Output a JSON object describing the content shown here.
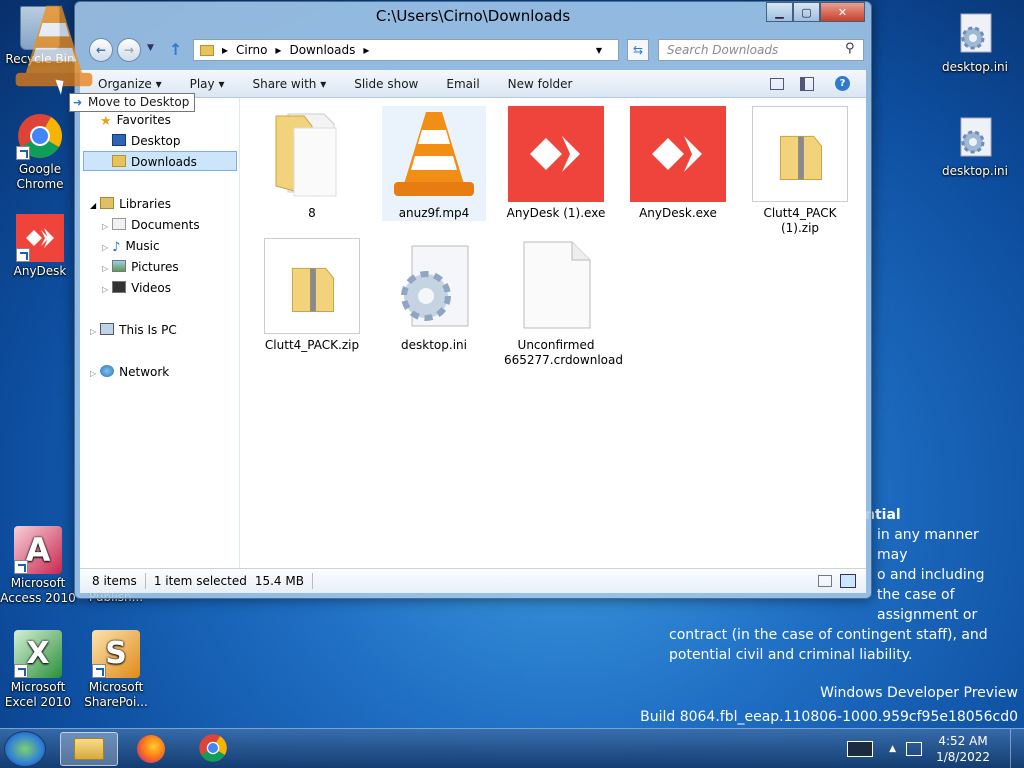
{
  "desktop": {
    "recycle_bin": "Recycle Bin",
    "chrome": "Google Chrome",
    "anydesk": "AnyDesk",
    "access": "Microsoft Access 2010",
    "publisher": "Publish...",
    "excel": "Microsoft Excel 2010",
    "sharepoint": "Microsoft SharePoi...",
    "ini1": "desktop.ini",
    "ini2": "desktop.ini"
  },
  "notice": {
    "title": "ntial",
    "lines": [
      "in any manner may",
      "o and including",
      "the case of",
      "assignment or",
      "contract (in the case of contingent staff), and",
      "potential civil and criminal liability."
    ]
  },
  "build": {
    "line1": "Windows Developer Preview",
    "line2": "Build 8064.fbl_eeap.110806-1000.959cf95e18056cd0"
  },
  "window": {
    "title": "C:\\Users\\Cirno\\Downloads",
    "crumb1": "Cirno",
    "crumb2": "Downloads",
    "search_placeholder": "Search Downloads",
    "toolbar": {
      "organize": "Organize ▾",
      "play": "Play ▾",
      "share": "Share with ▾",
      "slideshow": "Slide show",
      "email": "Email",
      "newfolder": "New folder"
    },
    "nav": {
      "favorites": "Favorites",
      "desktop": "Desktop",
      "downloads": "Downloads",
      "libraries": "Libraries",
      "documents": "Documents",
      "music": "Music",
      "pictures": "Pictures",
      "videos": "Videos",
      "thispc": "This Is PC",
      "network": "Network"
    },
    "files": [
      {
        "name": "8"
      },
      {
        "name": "anuz9f.mp4"
      },
      {
        "name": "AnyDesk (1).exe"
      },
      {
        "name": "AnyDesk.exe"
      },
      {
        "name": "Clutt4_PACK (1).zip"
      },
      {
        "name": "Clutt4_PACK.zip"
      },
      {
        "name": "desktop.ini"
      },
      {
        "name": "Unconfirmed 665277.crdownload"
      }
    ],
    "status": {
      "items": "8 items",
      "selected": "1 item selected",
      "size": "15.4 MB"
    }
  },
  "drag_tooltip": "Move to Desktop",
  "clock": {
    "time": "4:52 AM",
    "date": "1/8/2022"
  },
  "colors": {
    "anydesk_red": "#ef443b",
    "desktop_blue": "#1f6fc4"
  }
}
